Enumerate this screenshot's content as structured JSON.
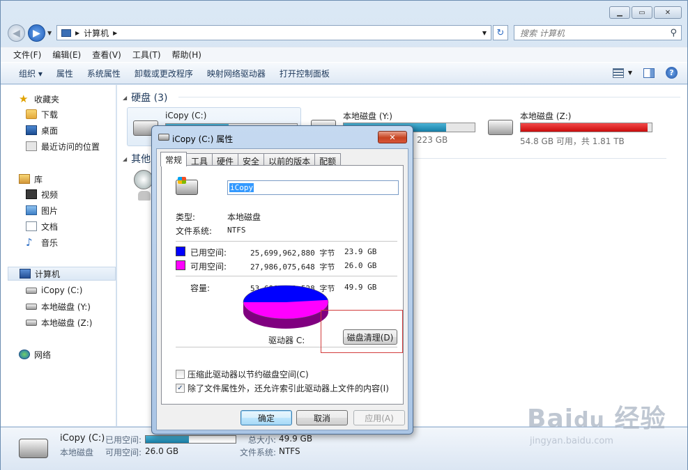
{
  "window": {
    "address": "计算机",
    "search_placeholder": "搜索 计算机"
  },
  "menu": [
    "文件(F)",
    "编辑(E)",
    "查看(V)",
    "工具(T)",
    "帮助(H)"
  ],
  "toolbar": [
    "组织 ▾",
    "属性",
    "系统属性",
    "卸载或更改程序",
    "映射网络驱动器",
    "打开控制面板"
  ],
  "nav": {
    "favorites": "收藏夹",
    "downloads": "下载",
    "desktop": "桌面",
    "recent": "最近访问的位置",
    "libraries": "库",
    "videos": "视频",
    "pictures": "图片",
    "documents": "文档",
    "music": "音乐",
    "computer": "计算机",
    "drive_c": "iCopy (C:)",
    "drive_y": "本地磁盘 (Y:)",
    "drive_z": "本地磁盘 (Z:)",
    "network": "网络"
  },
  "main": {
    "group_hdd": "硬盘 (3)",
    "group_other": "其他",
    "drives": [
      {
        "name": "iCopy (C:)",
        "free": "",
        "used_fraction": 0.48
      },
      {
        "name": "本地磁盘 (Y:)",
        "free": "223 GB",
        "used_fraction": 0.78
      },
      {
        "name": "本地磁盘 (Z:)",
        "free": "54.8 GB 可用，共 1.81 TB",
        "used_fraction": 0.97
      }
    ]
  },
  "details": {
    "name": "iCopy (C:)",
    "type": "本地磁盘",
    "used_label": "已用空间:",
    "free_label": "可用空间:",
    "free_value": "26.0 GB",
    "total_label": "总大小:",
    "total_value": "49.9 GB",
    "fs_label": "文件系统:",
    "fs_value": "NTFS",
    "used_fraction": 0.48
  },
  "dialog": {
    "title": "iCopy (C:) 属性",
    "tabs": [
      "常规",
      "工具",
      "硬件",
      "安全",
      "以前的版本",
      "配额"
    ],
    "volume_name": "iCopy",
    "type_label": "类型:",
    "type_value": "本地磁盘",
    "fs_label": "文件系统:",
    "fs_value": "NTFS",
    "used_label": "已用空间:",
    "used_bytes": "25,699,962,880 字节",
    "used_gb": "23.9 GB",
    "free_label": "可用空间:",
    "free_bytes": "27,986,075,648 字节",
    "free_gb": "26.0 GB",
    "cap_label": "容量:",
    "cap_bytes": "53,686,038,528 字节",
    "cap_gb": "49.9 GB",
    "drive_label": "驱动器 C:",
    "cleanup_btn": "磁盘清理(D)",
    "compress_label": "压缩此驱动器以节约磁盘空间(C)",
    "index_label": "除了文件属性外，还允许索引此驱动器上文件的内容(I)",
    "ok": "确定",
    "cancel": "取消",
    "apply": "应用(A)",
    "used_color": "#0000ff",
    "free_color": "#ff00ff",
    "used_fraction": 0.4787
  }
}
